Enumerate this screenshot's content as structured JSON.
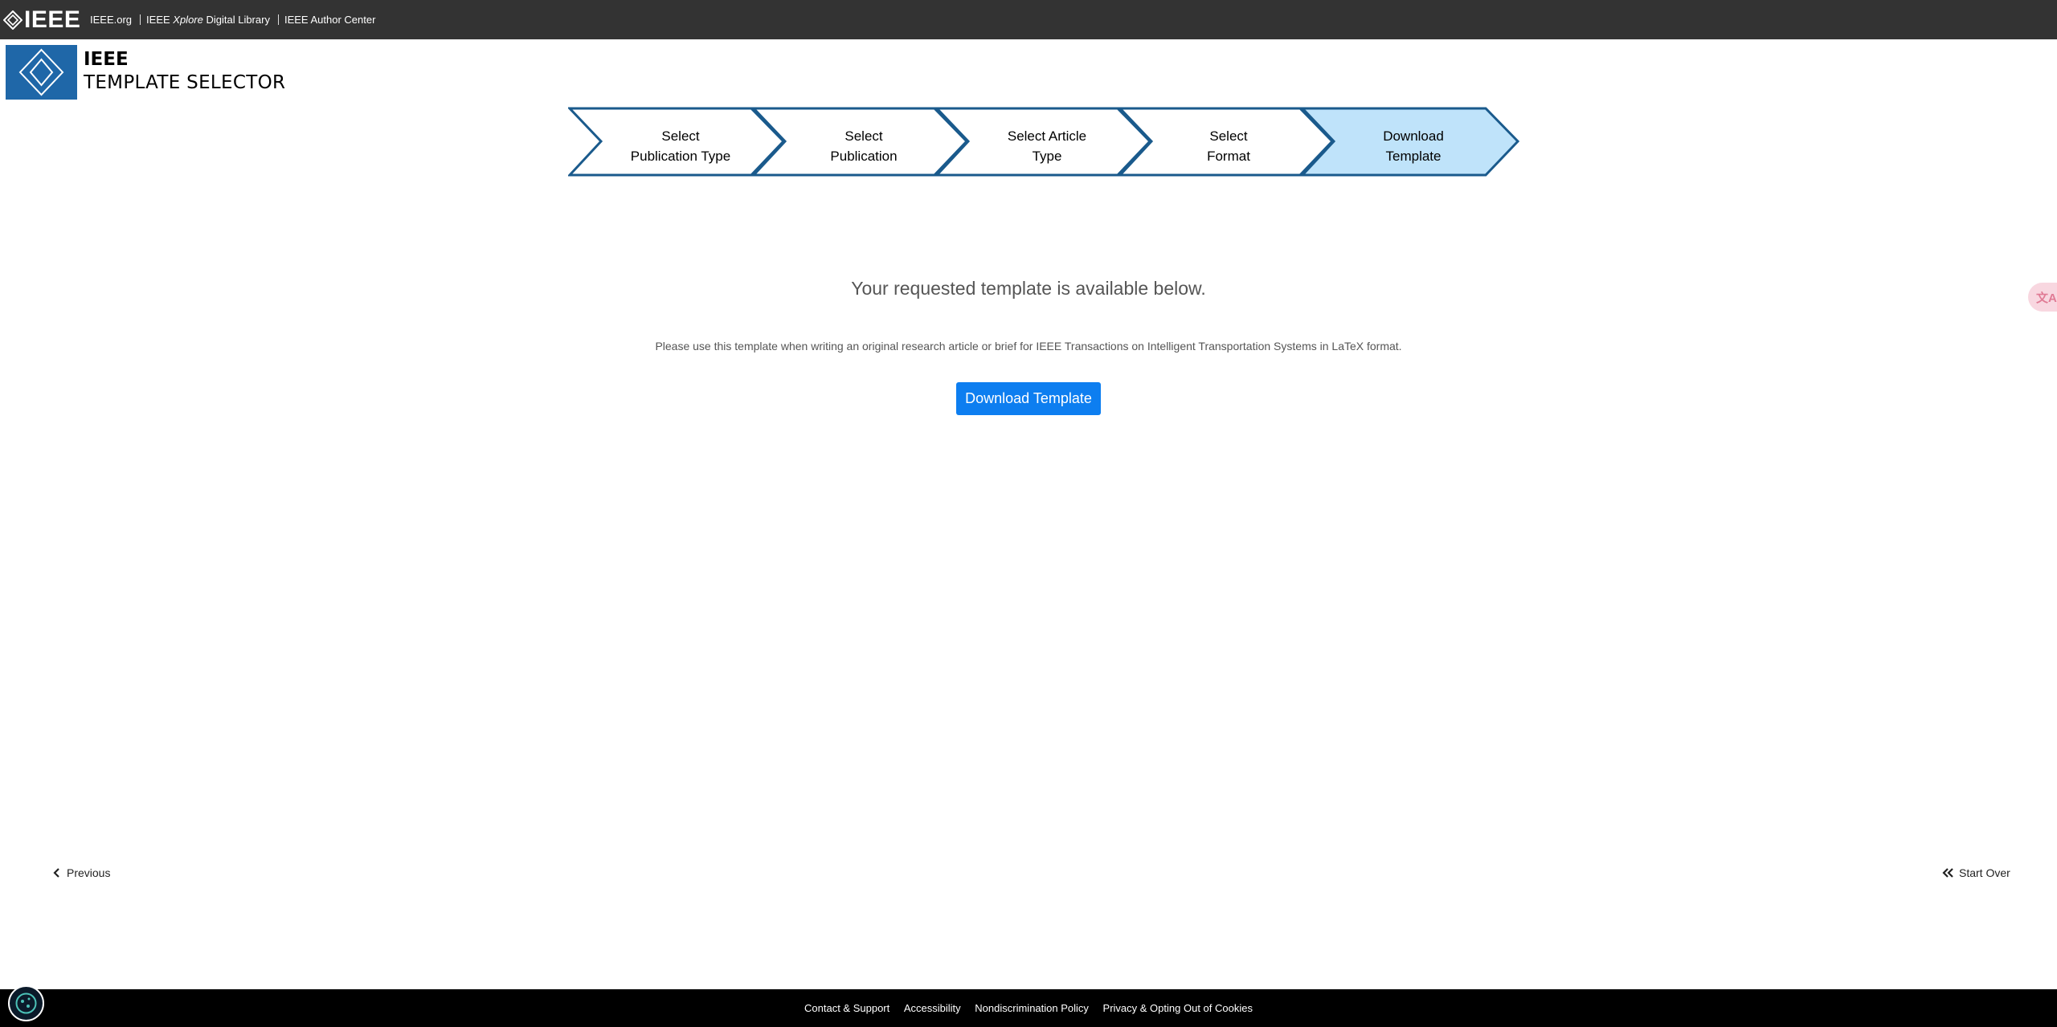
{
  "topbar": {
    "logo_text": "IEEE",
    "links": [
      {
        "label": "IEEE.org"
      },
      {
        "label_prefix": "IEEE ",
        "label_italic": "Xplore",
        "label_suffix": " Digital Library"
      },
      {
        "label": "IEEE Author Center"
      }
    ]
  },
  "brand": {
    "title": "IEEE",
    "subtitle": "TEMPLATE SELECTOR"
  },
  "stepper": {
    "steps": [
      {
        "line1": "Select",
        "line2": "Publication Type",
        "active": false
      },
      {
        "line1": "Select",
        "line2": "Publication",
        "active": false
      },
      {
        "line1": "Select Article",
        "line2": "Type",
        "active": false
      },
      {
        "line1": "Select",
        "line2": "Format",
        "active": false
      },
      {
        "line1": "Download",
        "line2": "Template",
        "active": true
      }
    ],
    "active_fill": "#bfe3fa",
    "stroke": "#1a5a8c"
  },
  "main": {
    "headline": "Your requested template is available below.",
    "description": "Please use this template when writing an original research article or brief for IEEE Transactions on Intelligent Transportation Systems in LaTeX format.",
    "download_label": "Download Template",
    "button_color": "#0d7ef0"
  },
  "nav": {
    "previous_label": "Previous",
    "start_over_label": "Start Over"
  },
  "side": {
    "translate_icon": "translate-icon"
  },
  "footer": {
    "links": [
      "Contact & Support",
      "Accessibility",
      "Nondiscrimination Policy",
      "Privacy & Opting Out of Cookies"
    ]
  }
}
